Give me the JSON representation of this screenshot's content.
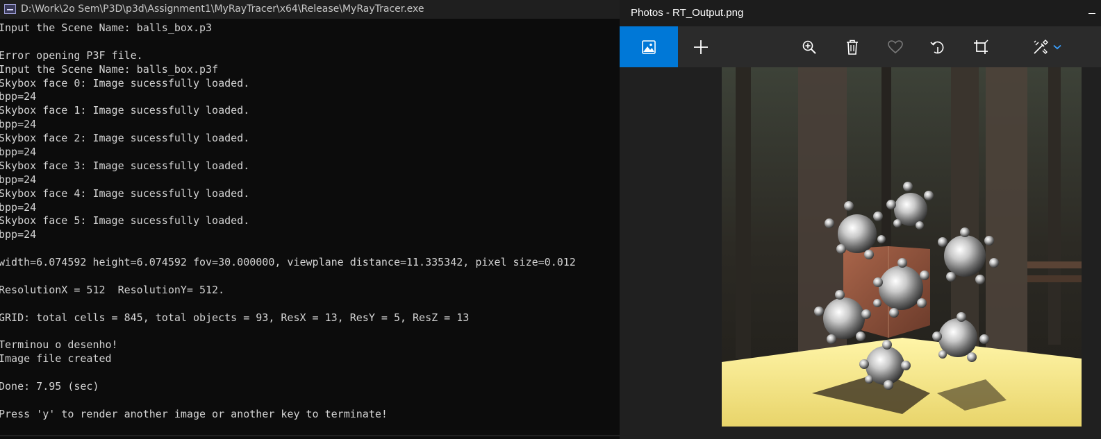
{
  "console": {
    "title": "D:\\Work\\2o Sem\\P3D\\p3d\\Assignment1\\MyRayTracer\\x64\\Release\\MyRayTracer.exe",
    "lines": [
      "Input the Scene Name: balls_box.p3",
      "",
      "Error opening P3F file.",
      "Input the Scene Name: balls_box.p3f",
      "Skybox face 0: Image sucessfully loaded.",
      "bpp=24",
      "Skybox face 1: Image sucessfully loaded.",
      "bpp=24",
      "Skybox face 2: Image sucessfully loaded.",
      "bpp=24",
      "Skybox face 3: Image sucessfully loaded.",
      "bpp=24",
      "Skybox face 4: Image sucessfully loaded.",
      "bpp=24",
      "Skybox face 5: Image sucessfully loaded.",
      "bpp=24",
      "",
      "width=6.074592 height=6.074592 fov=30.000000, viewplane distance=11.335342, pixel size=0.012",
      "",
      "ResolutionX = 512  ResolutionY= 512.",
      "",
      "GRID: total cells = 845, total objects = 93, ResX = 13, ResY = 5, ResZ = 13",
      "",
      "Terminou o desenho!",
      "Image file created",
      "",
      "Done: 7.95 (sec)",
      "",
      "Press 'y' to render another image or another key to terminate!"
    ]
  },
  "photos": {
    "title": "Photos - RT_Output.png",
    "accent_color": "#0078d7",
    "toolbar": {
      "view": "image-icon",
      "add": "plus-icon",
      "zoom": "zoom-in-icon",
      "delete": "trash-icon",
      "favorite": "heart-icon",
      "rotate": "rotate-icon",
      "crop": "crop-icon",
      "edit": "edit-create-icon",
      "more": "chevron-down-icon"
    }
  }
}
